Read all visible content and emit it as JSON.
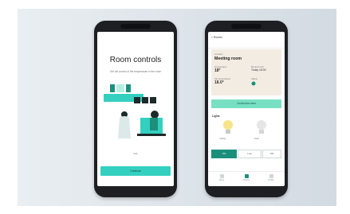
{
  "left_screen": {
    "title": "Room controls",
    "subtitle": "Get full control of the temperature in the room",
    "note": "Info",
    "cta": "Continue"
  },
  "right_screen": {
    "back": "< Rooms",
    "location_label": "Location",
    "room_name": "Meeting room",
    "temp_label": "Temperature",
    "temp_value": "18°",
    "time_label": "Booked until",
    "time_value": "Today 16:00",
    "set_temp_label": "Set temperature",
    "set_temp_value": "18.0°",
    "status_label": "Status",
    "button": "Control the room",
    "lights_title": "Lights",
    "bulb1_label": "Ceiling",
    "bulb2_label": "Desk",
    "segments": [
      "ON",
      "Low",
      "Off"
    ],
    "nav": [
      "Home",
      "Rooms",
      "Profile"
    ]
  },
  "colors": {
    "accent": "#33d0c0",
    "mint": "#78e0c2",
    "dark_teal": "#1c8f7c",
    "card": "#f3ece2",
    "bulb_on": "#f7e58a",
    "bulb_off": "#e6e6e6"
  }
}
